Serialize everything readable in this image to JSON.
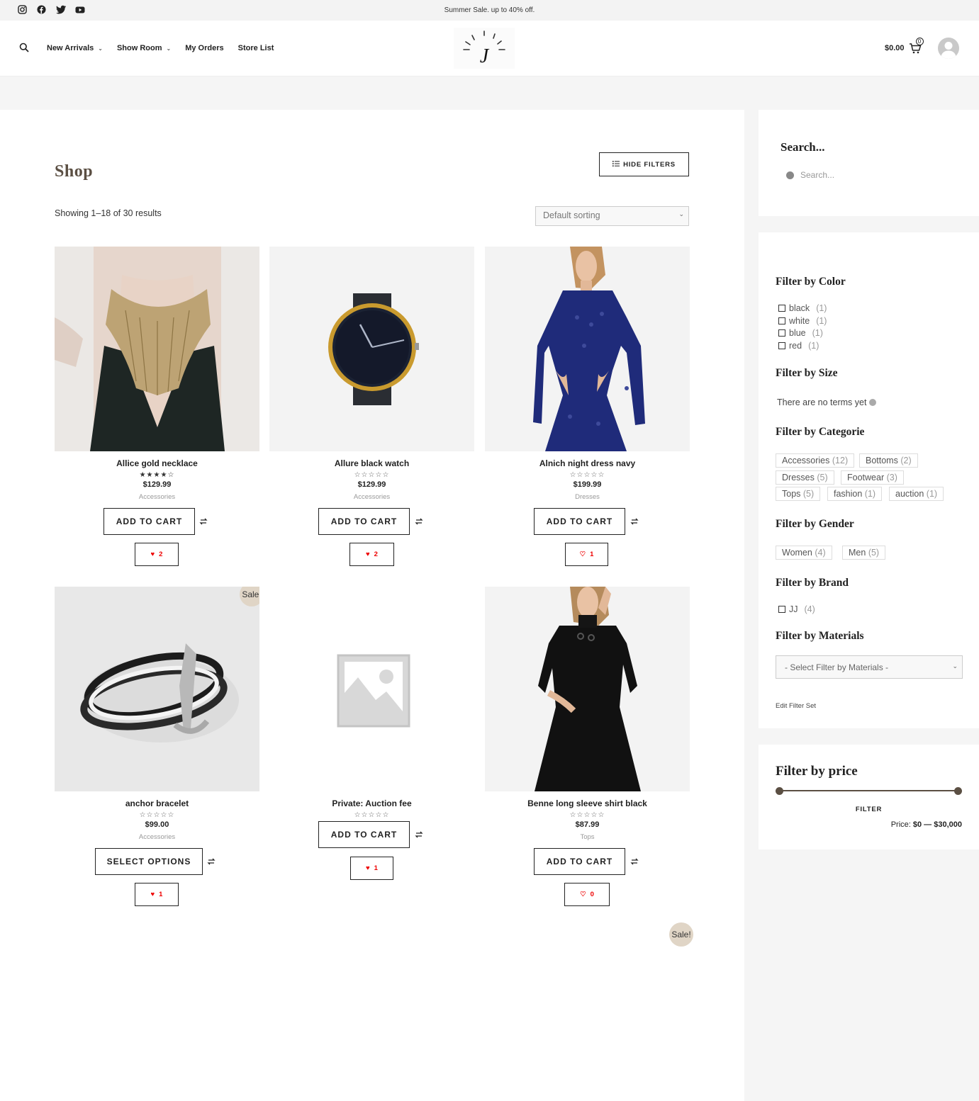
{
  "topbar": {
    "socials": [
      "instagram-icon",
      "facebook-icon",
      "twitter-icon",
      "youtube-icon"
    ],
    "promo": "Summer Sale. up to 40% off."
  },
  "header": {
    "nav": [
      {
        "label": "New Arrivals",
        "has_dropdown": true
      },
      {
        "label": "Show Room",
        "has_dropdown": true
      },
      {
        "label": "My Orders",
        "has_dropdown": false
      },
      {
        "label": "Store List",
        "has_dropdown": false
      }
    ],
    "cart_total": "$0.00",
    "cart_count": "0"
  },
  "shop": {
    "title": "Shop",
    "hide_filters": "HIDE FILTERS",
    "result_count": "Showing 1–18 of 30 results",
    "sorting": "Default sorting"
  },
  "products": [
    {
      "name": "Allice gold necklace",
      "price": "$129.99",
      "category": "Accessories",
      "rating": 4,
      "button": "ADD TO CART",
      "wishlist": "2",
      "wish_filled": true
    },
    {
      "name": "Allure black watch",
      "price": "$129.99",
      "category": "Accessories",
      "rating": 0,
      "button": "ADD TO CART",
      "wishlist": "2",
      "wish_filled": true
    },
    {
      "name": "Alnich night dress navy",
      "price": "$199.99",
      "category": "Dresses",
      "rating": 0,
      "button": "ADD TO CART",
      "wishlist": "1",
      "wish_filled": false
    },
    {
      "name": "anchor bracelet",
      "price": "$99.00",
      "category": "Accessories",
      "rating": 0,
      "button": "SELECT OPTIONS",
      "wishlist": "1",
      "wish_filled": true,
      "sale": "Sale!"
    },
    {
      "name": "Private: Auction fee",
      "price": "",
      "category": "",
      "rating": 0,
      "button": "ADD TO CART",
      "wishlist": "1",
      "wish_filled": true
    },
    {
      "name": "Benne long sleeve shirt black",
      "price": "$87.99",
      "category": "Tops",
      "rating": 0,
      "button": "ADD TO CART",
      "wishlist": "0",
      "wish_filled": false
    }
  ],
  "extra_sale_badge": "Sale!",
  "sidebar": {
    "search_title": "Search...",
    "search_placeholder": "Search...",
    "color_title": "Filter by Color",
    "colors": [
      {
        "label": "black",
        "count": "(1)"
      },
      {
        "label": "white",
        "count": "(1)"
      },
      {
        "label": "blue",
        "count": "(1)"
      },
      {
        "label": "red",
        "count": "(1)"
      }
    ],
    "size_title": "Filter by Size",
    "size_empty": "There are no terms yet",
    "category_title": "Filter by Categorie",
    "categories": [
      {
        "label": "Accessories",
        "count": "(12)"
      },
      {
        "label": "Bottoms",
        "count": "(2)"
      },
      {
        "label": "Dresses",
        "count": "(5)"
      },
      {
        "label": "Footwear",
        "count": "(3)"
      },
      {
        "label": "Tops",
        "count": "(5)"
      },
      {
        "label": "fashion",
        "count": "(1)"
      },
      {
        "label": "auction",
        "count": "(1)"
      }
    ],
    "gender_title": "Filter by Gender",
    "genders": [
      {
        "label": "Women",
        "count": "(4)"
      },
      {
        "label": "Men",
        "count": "(5)"
      }
    ],
    "brand_title": "Filter by Brand",
    "brands": [
      {
        "label": "JJ",
        "count": "(4)"
      }
    ],
    "materials_title": "Filter by Materials",
    "materials_select": "- Select Filter by Materials -",
    "edit_filter": "Edit Filter Set",
    "price_title": "Filter by price",
    "price_filter_btn": "FILTER",
    "price_label": "Price:",
    "price_range": "$0 — $30,000"
  },
  "colors": {
    "accent": "#5b4f43",
    "sale": "#e0d5c6",
    "heart": "#e00000"
  }
}
